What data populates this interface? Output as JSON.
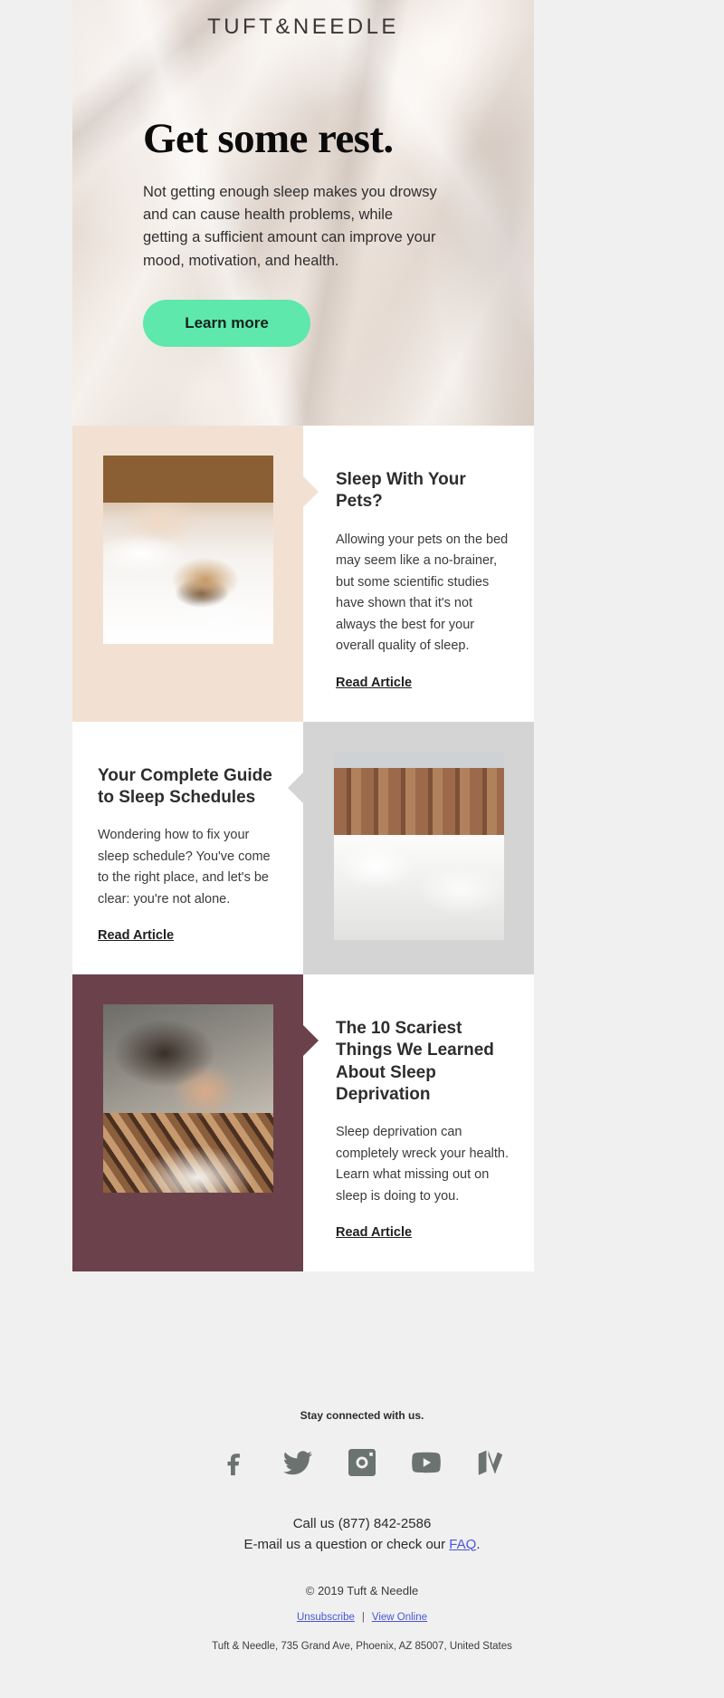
{
  "brand": {
    "logo": "TUFT&NEEDLE"
  },
  "hero": {
    "title": "Get some rest.",
    "body": "Not getting enough sleep makes you drowsy and can cause health problems, while getting a sufficient amount can improve your mood, motivation, and health.",
    "cta_label": "Learn more",
    "cta_color": "#5FE8AC"
  },
  "cards": [
    {
      "title": "Sleep With Your Pets?",
      "body": "Allowing your pets on the bed may seem like a no-brainer, but some scientific studies have shown that it's not always the best for your overall quality of sleep.",
      "link_label": "Read Article",
      "panel_color": "#F2E1D2",
      "image_alt": "child and pug dog sleeping in bed"
    },
    {
      "title": "Your Complete Guide to Sleep Schedules",
      "body": "Wondering how to fix your sleep schedule? You've come to the right place, and let's be clear: you're not alone.",
      "link_label": "Read Article",
      "panel_color": "#D4D4D4",
      "image_alt": "wooden headboard bed with white bedding"
    },
    {
      "title": "The 10 Scariest Things We Learned About Sleep Deprivation",
      "body": "Sleep deprivation can completely wreck your health. Learn what missing out on sleep is doing to you.",
      "link_label": "Read Article",
      "panel_color": "#6B424B",
      "image_alt": "person lying curled up on a bed"
    }
  ],
  "footer": {
    "stay_connected": "Stay connected with us.",
    "socials": [
      {
        "name": "facebook-icon",
        "label": "Facebook"
      },
      {
        "name": "twitter-icon",
        "label": "Twitter"
      },
      {
        "name": "instagram-icon",
        "label": "Instagram"
      },
      {
        "name": "youtube-icon",
        "label": "YouTube"
      },
      {
        "name": "map-icon",
        "label": "Map"
      }
    ],
    "icon_color": "#6B7370",
    "call_line": "Call us (877) 842-2586",
    "email_line_prefix": "E-mail us a question or check our ",
    "faq_label": "FAQ",
    "email_line_suffix": ".",
    "copyright": "© 2019 Tuft & Needle",
    "unsubscribe": "Unsubscribe",
    "separator": "|",
    "view_online": "View Online",
    "address": "Tuft & Needle, 735 Grand Ave, Phoenix, AZ 85007, United States",
    "link_color": "#4A55D6"
  }
}
